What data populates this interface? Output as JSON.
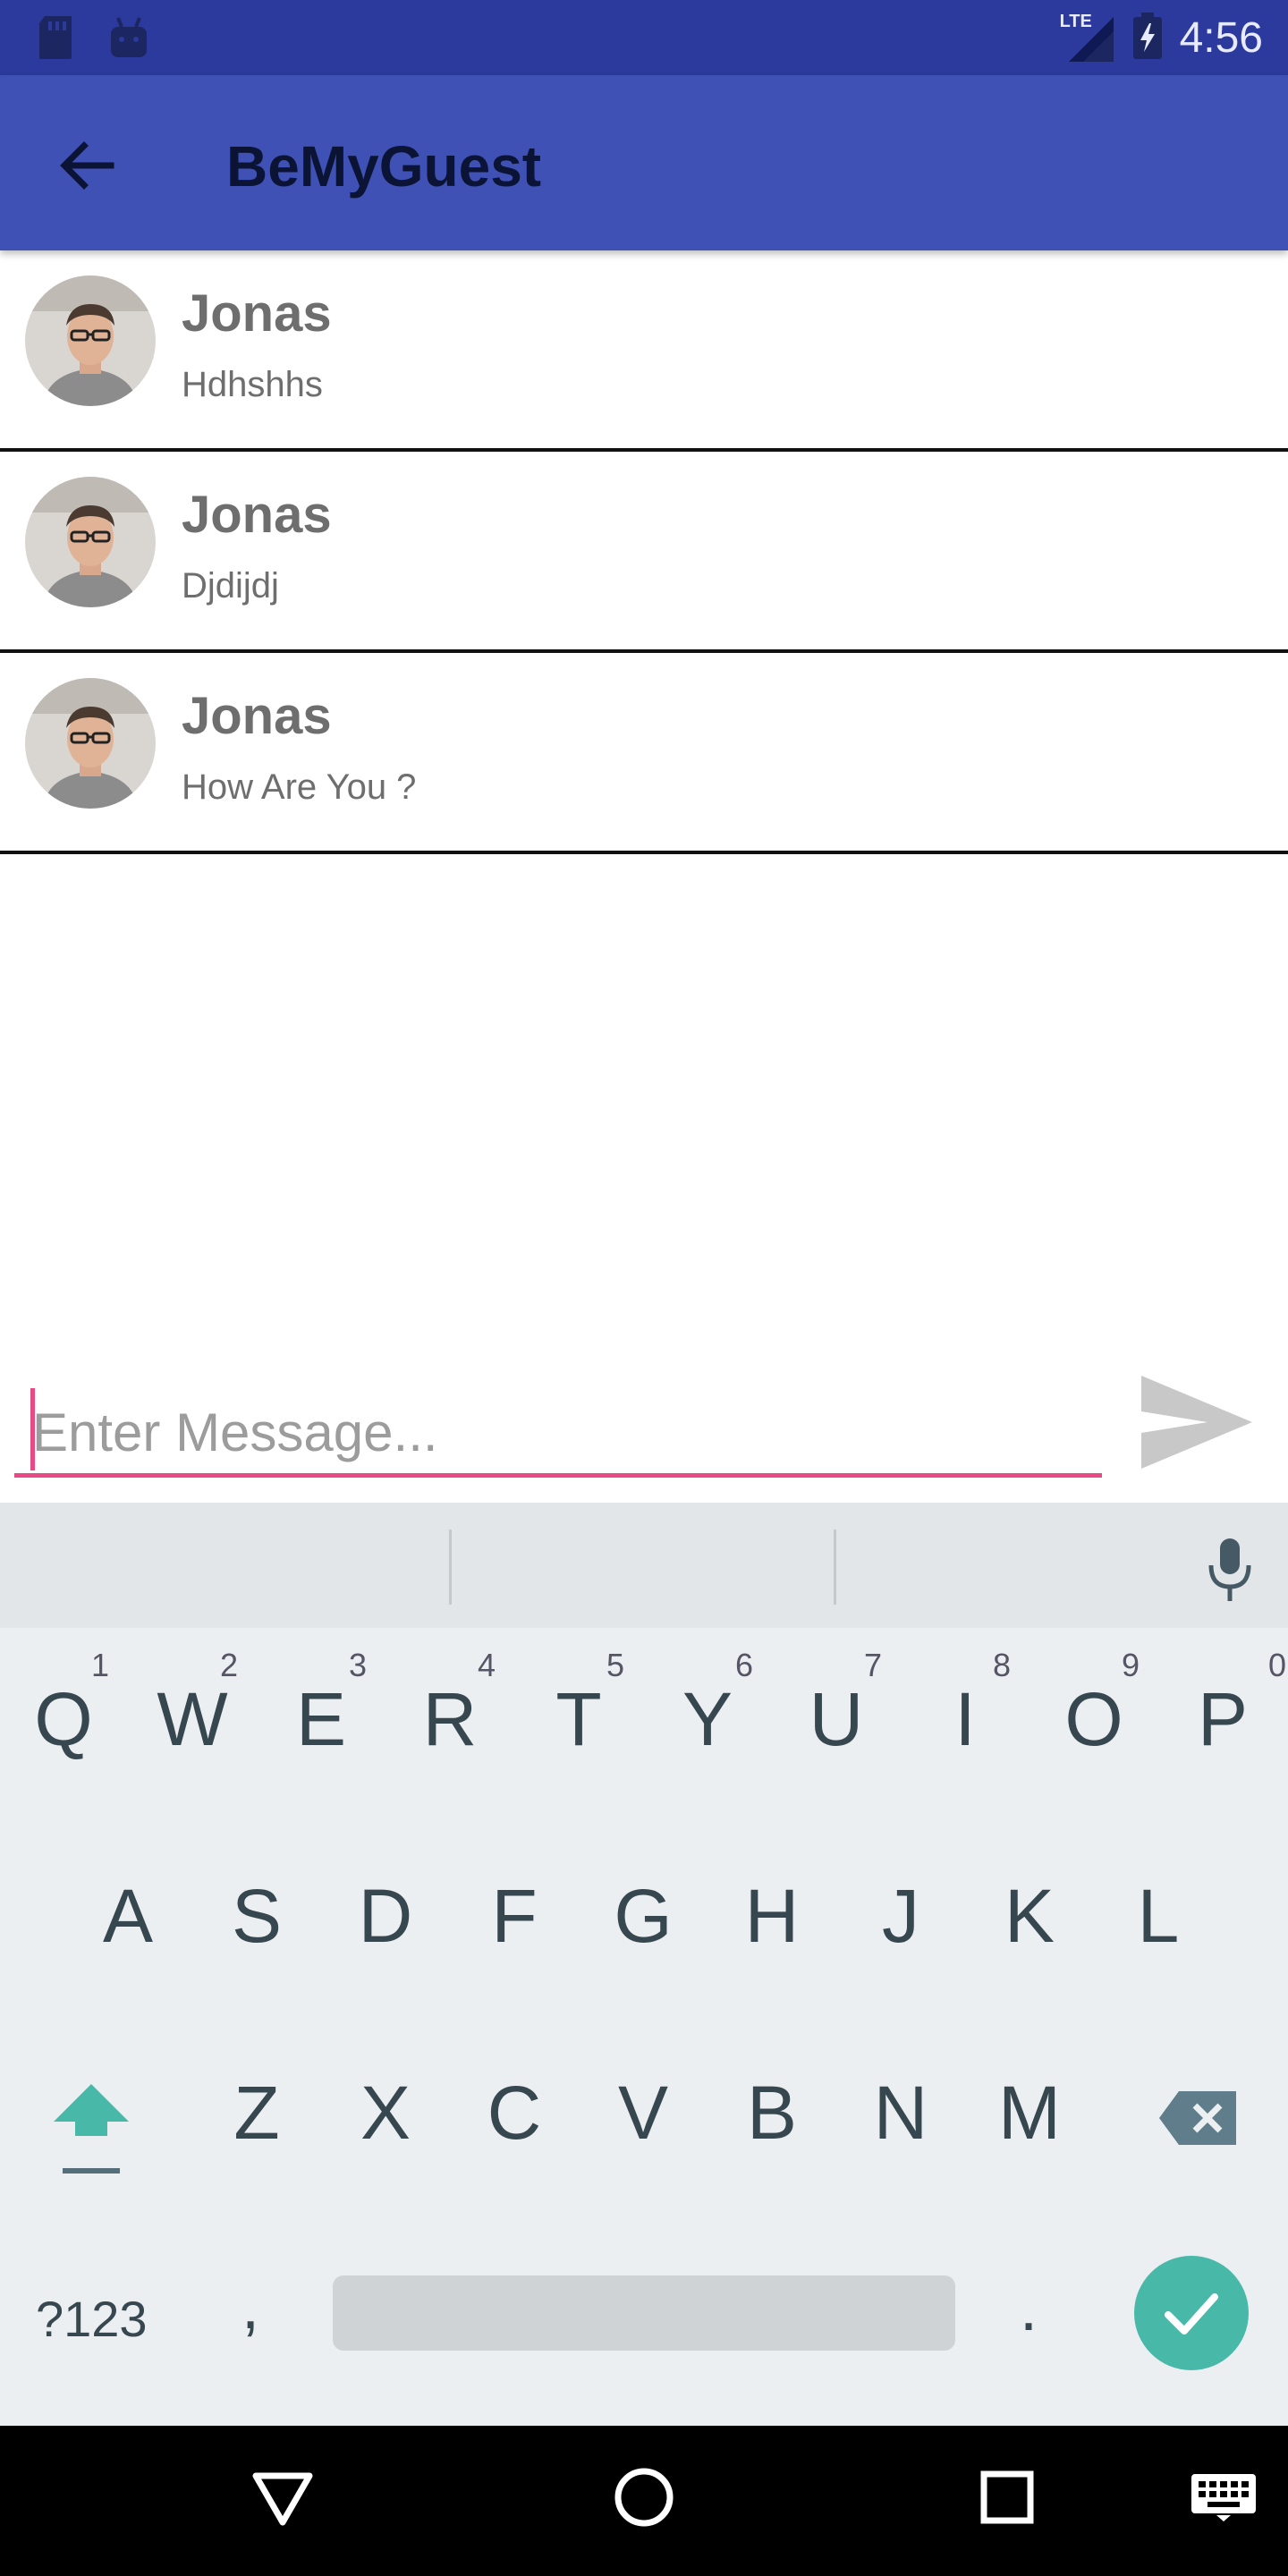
{
  "status_bar": {
    "time": "4:56",
    "network": "LTE"
  },
  "app_bar": {
    "title": "BeMyGuest"
  },
  "chats": [
    {
      "name": "Jonas",
      "message": "Hdhshhs"
    },
    {
      "name": "Jonas",
      "message": "Djdijdj"
    },
    {
      "name": "Jonas",
      "message": "How Are You ?"
    }
  ],
  "composer": {
    "placeholder": "Enter Message...",
    "value": ""
  },
  "keyboard": {
    "row1": [
      {
        "key": "Q",
        "num": "1"
      },
      {
        "key": "W",
        "num": "2"
      },
      {
        "key": "E",
        "num": "3"
      },
      {
        "key": "R",
        "num": "4"
      },
      {
        "key": "T",
        "num": "5"
      },
      {
        "key": "Y",
        "num": "6"
      },
      {
        "key": "U",
        "num": "7"
      },
      {
        "key": "I",
        "num": "8"
      },
      {
        "key": "O",
        "num": "9"
      },
      {
        "key": "P",
        "num": "0"
      }
    ],
    "row2": [
      "A",
      "S",
      "D",
      "F",
      "G",
      "H",
      "J",
      "K",
      "L"
    ],
    "row3": [
      "Z",
      "X",
      "C",
      "V",
      "B",
      "N",
      "M"
    ],
    "symbols_label": "?123",
    "comma": ",",
    "period": "."
  },
  "colors": {
    "status_bar": "#2b3a9c",
    "app_bar": "#3f51b5",
    "input_accent": "#e84a86",
    "enter_key": "#48b8a8",
    "keyboard_bg": "#eceff1"
  },
  "icons": [
    "sd-card-icon",
    "android-icon",
    "lte-signal-icon",
    "battery-charging-icon",
    "back-arrow-icon",
    "send-icon",
    "mic-icon",
    "shift-icon",
    "backspace-icon",
    "check-icon",
    "nav-back-icon",
    "nav-home-icon",
    "nav-recents-icon",
    "keyboard-icon"
  ]
}
